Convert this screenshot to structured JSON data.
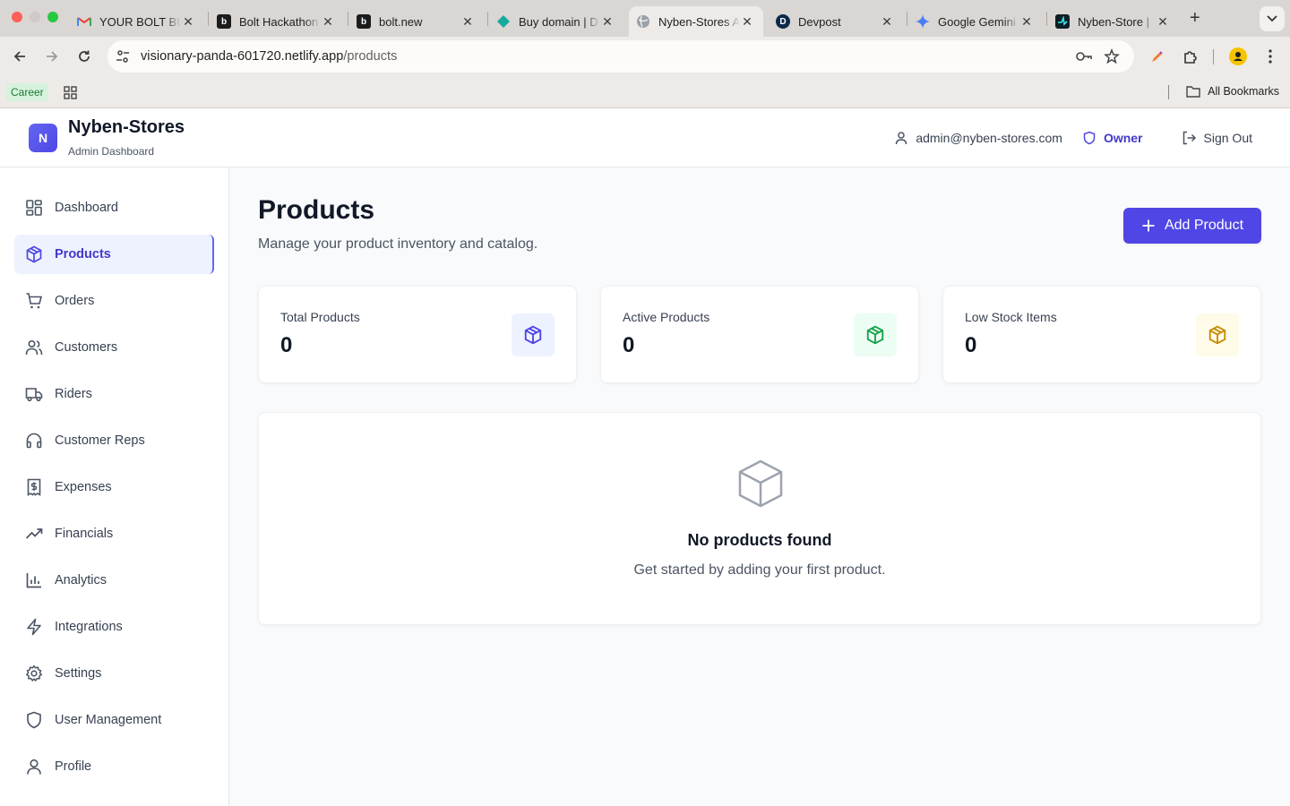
{
  "browser": {
    "tabs": [
      {
        "title": "YOUR BOLT BU",
        "favicon": "gmail-icon"
      },
      {
        "title": "Bolt Hackathon",
        "favicon": "bolt-b-icon"
      },
      {
        "title": "bolt.new",
        "favicon": "bolt-b-icon"
      },
      {
        "title": "Buy domain | D",
        "favicon": "domain-diamond-icon"
      },
      {
        "title": "Nyben-Stores A",
        "favicon": "globe-icon",
        "active": true
      },
      {
        "title": "Devpost",
        "favicon": "devpost-icon"
      },
      {
        "title": "Google Gemini",
        "favicon": "gemini-icon"
      },
      {
        "title": "Nyben-Store |",
        "favicon": "netlify-icon"
      }
    ],
    "url_host": "visionary-panda-601720.netlify.app",
    "url_path": "/products",
    "bookmarks": {
      "career": "Career",
      "all": "All Bookmarks"
    }
  },
  "header": {
    "logo_letter": "N",
    "brand": "Nyben-Stores",
    "subtitle": "Admin Dashboard",
    "email": "admin@nyben-stores.com",
    "role": "Owner",
    "signout": "Sign Out"
  },
  "sidebar": {
    "items": [
      {
        "label": "Dashboard",
        "icon": "dashboard-grid-icon"
      },
      {
        "label": "Products",
        "icon": "package-icon",
        "active": true
      },
      {
        "label": "Orders",
        "icon": "cart-icon"
      },
      {
        "label": "Customers",
        "icon": "users-icon"
      },
      {
        "label": "Riders",
        "icon": "truck-icon"
      },
      {
        "label": "Customer Reps",
        "icon": "headphones-icon"
      },
      {
        "label": "Expenses",
        "icon": "receipt-icon"
      },
      {
        "label": "Financials",
        "icon": "trending-up-icon"
      },
      {
        "label": "Analytics",
        "icon": "bar-chart-icon"
      },
      {
        "label": "Integrations",
        "icon": "zap-icon"
      },
      {
        "label": "Settings",
        "icon": "gear-icon"
      },
      {
        "label": "User Management",
        "icon": "shield-icon"
      },
      {
        "label": "Profile",
        "icon": "user-icon"
      }
    ]
  },
  "main": {
    "title": "Products",
    "subtitle": "Manage your product inventory and catalog.",
    "add_button": "Add Product",
    "stats": [
      {
        "label": "Total Products",
        "value": "0",
        "color": "#4f46e5",
        "bg": "#eef2ff"
      },
      {
        "label": "Active Products",
        "value": "0",
        "color": "#16a34a",
        "bg": "#ecfdf3"
      },
      {
        "label": "Low Stock Items",
        "value": "0",
        "color": "#ca8a04",
        "bg": "#fefce8"
      }
    ],
    "empty_title": "No products found",
    "empty_sub": "Get started by adding your first product."
  }
}
